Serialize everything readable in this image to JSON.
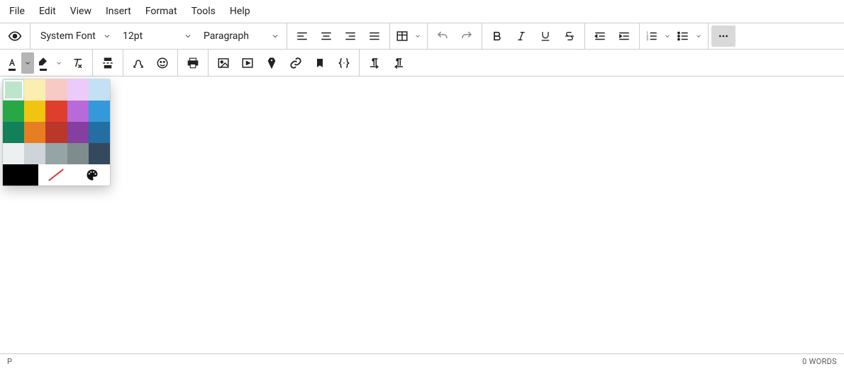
{
  "menubar": [
    "File",
    "Edit",
    "View",
    "Insert",
    "Format",
    "Tools",
    "Help"
  ],
  "toolbar": {
    "font": "System Font",
    "size": "12pt",
    "block": "Paragraph"
  },
  "icons": {
    "preview": "preview-icon",
    "bold": "bold-icon",
    "italic": "italic-icon",
    "underline": "underline-icon",
    "strike": "strike-icon",
    "alignL": "align-left-icon",
    "alignC": "align-center-icon",
    "alignR": "align-right-icon",
    "alignJ": "align-justify-icon",
    "table": "table-icon",
    "undo": "undo-icon",
    "redo": "redo-icon",
    "outdent": "outdent-icon",
    "indent": "indent-icon",
    "ol": "ordered-list-icon",
    "ul": "unordered-list-icon",
    "more": "more-icon",
    "textcolor": "text-color-icon",
    "highlight": "highlight-icon",
    "clear": "clear-format-icon",
    "pagebreak": "page-break-icon",
    "omega": "special-char-icon",
    "emoji": "emoji-icon",
    "print": "print-icon",
    "image": "image-icon",
    "media": "media-icon",
    "stamp": "anchor-icon",
    "link": "link-icon",
    "bookmark": "bookmark-icon",
    "code": "code-sample-icon",
    "ltr": "ltr-icon",
    "rtl": "rtl-icon",
    "palette": "custom-color-icon",
    "nocolor": "no-color-icon"
  },
  "colorpicker": {
    "selected": 0,
    "swatches": [
      "#BDE5CB",
      "#FCEDB1",
      "#F8CAC6",
      "#ECCAFA",
      "#C3E0F4",
      "#28A745",
      "#F1C40F",
      "#E03E2D",
      "#B96AD9",
      "#3598DB",
      "#128059",
      "#E67E22",
      "#BA372A",
      "#843FA1",
      "#236FA1",
      "#ECF0F1",
      "#CED4D9",
      "#95A5A6",
      "#7E8C8D",
      "#34495E"
    ],
    "black": "#000000"
  },
  "status": {
    "path": "P",
    "words": "0 WORDS"
  }
}
